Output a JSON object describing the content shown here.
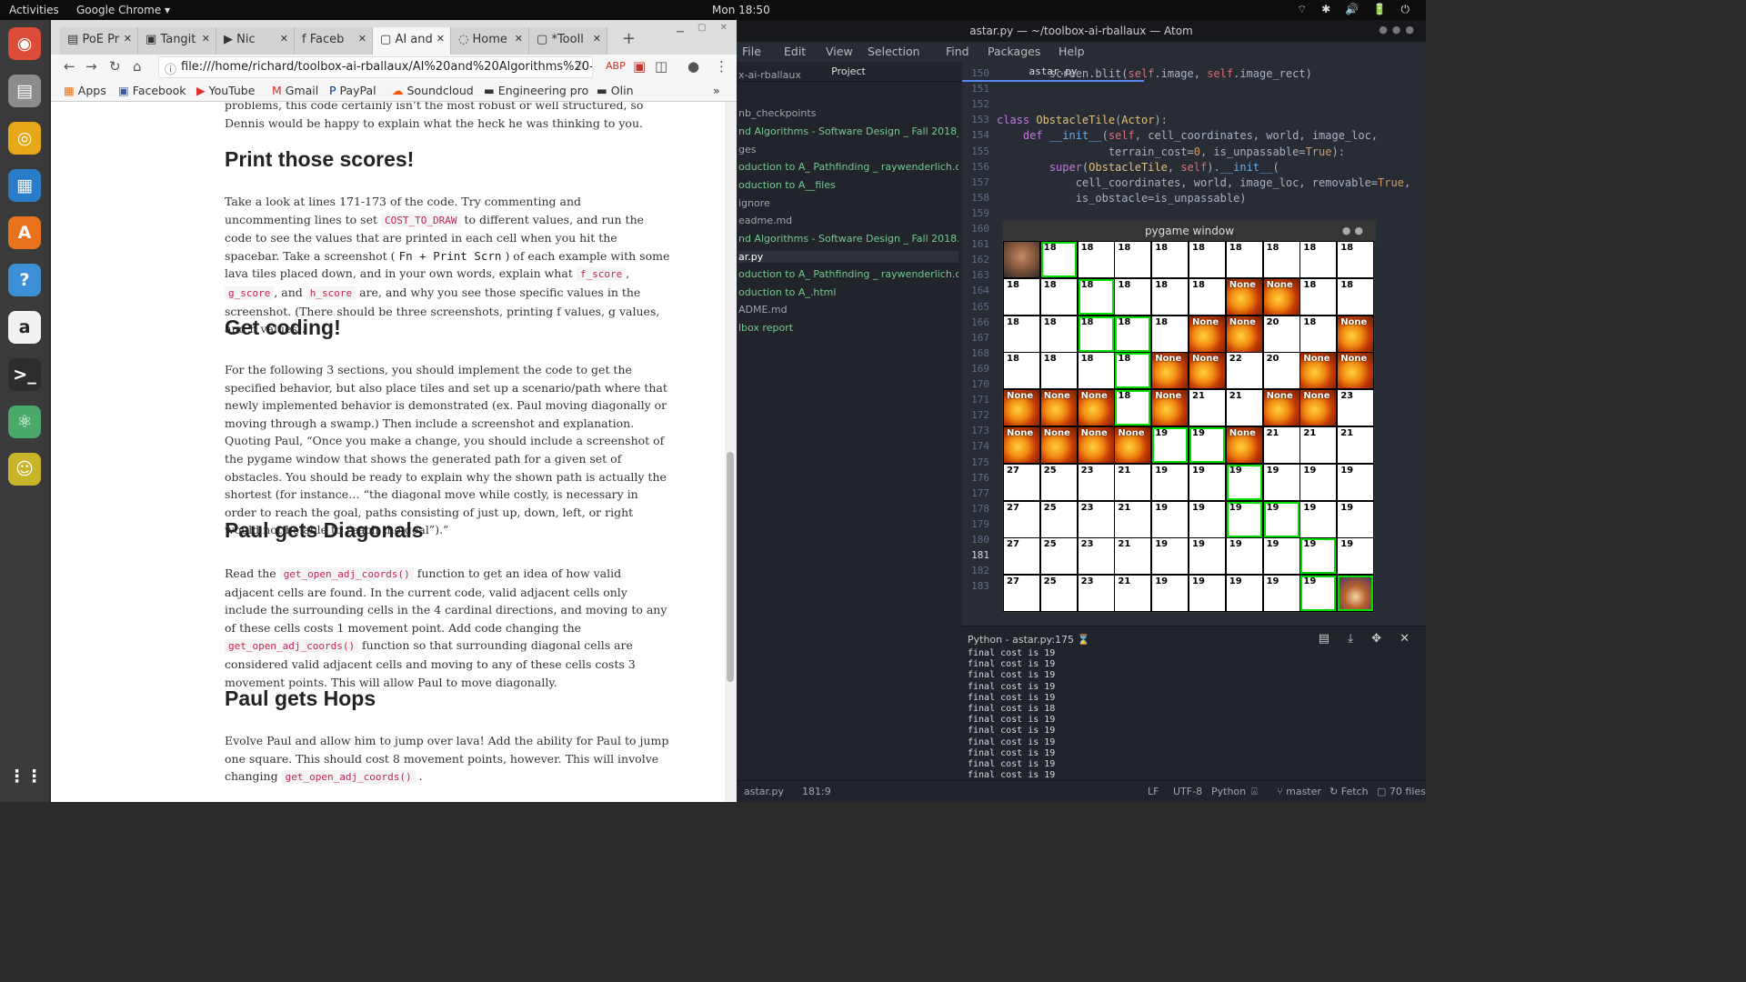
{
  "topbar": {
    "activities": "Activities",
    "app": "Google Chrome ▾",
    "clock": "Mon 18:50",
    "tray": "⌔ ✱ 🔊 🔋 ⏻"
  },
  "dock": [
    {
      "icon": "chrome-icon",
      "glyph": "◉",
      "color": "#dd4b39"
    },
    {
      "icon": "files-icon",
      "glyph": "▤",
      "color": "#8c8c8c"
    },
    {
      "icon": "rhythmbox-icon",
      "glyph": "◎",
      "color": "#e6a817"
    },
    {
      "icon": "writer-icon",
      "glyph": "▦",
      "color": "#2a7bc8"
    },
    {
      "icon": "software-center-icon",
      "glyph": "A",
      "color": "#e8731c"
    },
    {
      "icon": "help-icon",
      "glyph": "?",
      "color": "#3d8fd6"
    },
    {
      "icon": "amazon-icon",
      "glyph": "a",
      "color": "#f1f1f1"
    },
    {
      "icon": "terminal-icon",
      "glyph": ">_",
      "color": "#2d2d2d"
    },
    {
      "icon": "atom-icon",
      "glyph": "⚛",
      "color": "#4aa86a"
    },
    {
      "icon": "robot-icon",
      "glyph": "☺",
      "color": "#c8b428"
    },
    {
      "icon": "show-apps-icon",
      "glyph": "⋮⋮",
      "color": "#3a3a3a"
    }
  ],
  "chrome": {
    "tabs": [
      {
        "label": "PoE Pr",
        "icon": "▤",
        "active": false
      },
      {
        "label": "Tangit",
        "icon": "▣",
        "active": false
      },
      {
        "label": "Nic",
        "icon": "▶",
        "active": false
      },
      {
        "label": "Faceb",
        "icon": "f",
        "active": false
      },
      {
        "label": "AI and",
        "icon": "▢",
        "active": true
      },
      {
        "label": "Home",
        "icon": "◌",
        "active": false
      },
      {
        "label": "*Tooll",
        "icon": "▢",
        "active": false
      }
    ],
    "url": "file:///home/richard/toolbox-ai-rballaux/AI%20and%20Algorithms%20-%20Soft...",
    "bookmarks": [
      "Apps",
      "Facebook",
      "YouTube",
      "Gmail",
      "PayPal",
      "Soundcloud",
      "Engineering pro",
      "Olin"
    ],
    "more": "»"
  },
  "article": {
    "intro": "problems, this code certainly isn’t the most robust or well structured, so Dennis would be happy to explain what the heck he was thinking to you.",
    "h_print": "Print those scores!",
    "p_print_1": "Take a look at lines 171-173 of the code. Try commenting and uncommenting lines to set",
    "c_cost": "COST_TO_DRAW",
    "p_print_2": " to different values, and run the code to see the values that are printed in each cell when you hit the spacebar. Take a screenshot (",
    "c_key": "Fn + Print Scrn",
    "p_print_3": ") of each example with some lava tiles placed down, and in your own words, explain what",
    "c_f": "f_score",
    "c_g": "g_score",
    "p_and": ", and",
    "c_h": "h_score",
    "p_print_4": " are, and why you see those specific values in the screenshot. (There should be three screenshots, printing f values, g values, and h values).",
    "h_coding": "Get coding!",
    "p_coding": "For the following 3 sections, you should implement the code to get the specified behavior, but also place tiles and set up a scenario/path where that newly implemented behavior is demonstrated (ex. Paul moving diagonally or moving through a swamp.) Then include a screenshot and explanation. Quoting Paul, “Once you make a change, you should include a screenshot of the pygame window that shows the generated path for a given set of obstacles. You should be ready to explain why the shown path is actually the shortest (for instance… “the diagonal move while costly, is necessary in order to reach the goal, paths consisting of just up, down, left, or right would not be able to reach the goal”).”",
    "h_diag": "Paul gets Diagonals",
    "p_diag_1": "Read the ",
    "c_adj": "get_open_adj_coords()",
    "p_diag_2": " function to get an idea of how valid adjacent cells are found. In the current code, valid adjacent cells only include the surrounding cells in the 4 cardinal directions, and moving to any of these cells costs 1 movement point. Add code changing the ",
    "p_diag_3": " function so that surrounding diagonal cells are considered valid adjacent cells and moving to any of these cells costs 3 movement points. This will allow Paul to move diagonally.",
    "h_hops": "Paul gets Hops",
    "p_hops": "Evolve Paul and allow him to jump over lava! Add the ability for Paul to jump one square. This should cost 8 movement points, however. This will involve changing",
    "p_dot": "."
  },
  "atom": {
    "title": "astar.py — ~/toolbox-ai-rballaux — Atom",
    "menu": [
      "File",
      "Edit",
      "View",
      "Selection",
      "Find",
      "Packages",
      "Help"
    ],
    "project_label": "Project",
    "tab": "astar.py",
    "tree": [
      {
        "name": "x-ai-rballaux",
        "color": "#9da5b4"
      },
      {
        "name": "nb_checkpoints",
        "color": "#9da5b4"
      },
      {
        "name": "nd Algorithms - Software Design _ Fall 2018_files",
        "color": "#73c990"
      },
      {
        "name": "ges",
        "color": "#9da5b4"
      },
      {
        "name": "oduction to A_ Pathfinding _ raywenderlich.com_files",
        "color": "#73c990"
      },
      {
        "name": "oduction to A__files",
        "color": "#73c990"
      },
      {
        "name": "ignore",
        "color": "#9da5b4"
      },
      {
        "name": "eadme.md",
        "color": "#9da5b4"
      },
      {
        "name": "nd Algorithms - Software Design _ Fall 2018.html",
        "color": "#73c990"
      },
      {
        "name": "ar.py",
        "color": "#e2c08d"
      },
      {
        "name": "oduction to A_ Pathfinding _ raywenderlich.com.html",
        "color": "#73c990"
      },
      {
        "name": "oduction to A_.html",
        "color": "#73c990"
      },
      {
        "name": "ADME.md",
        "color": "#9da5b4"
      },
      {
        "name": "lbox report",
        "color": "#73c990"
      }
    ],
    "line_numbers": [
      "150",
      "151",
      "152",
      "153",
      "154",
      "155",
      "156",
      "157",
      "158",
      "159",
      "160",
      "161",
      "162",
      "163",
      "164",
      "165",
      "166",
      "167",
      "168",
      "169",
      "170",
      "171",
      "172",
      "173",
      "174",
      "175",
      "176",
      "177",
      "178",
      "179",
      "180",
      "181",
      "182",
      "183"
    ],
    "code": [
      "        screen.blit(self.image, self.image_rect)",
      "",
      "",
      "class ObstacleTile(Actor):",
      "    def __init__(self, cell_coordinates, world, image_loc,",
      "                 terrain_cost=0, is_unpassable=True):",
      "        super(ObstacleTile, self).__init__(",
      "            cell_coordinates, world, image_loc, removable=True,",
      "            is_obstacle=is_unpassable)"
    ],
    "console_title": "Python - astar.py:175",
    "console_lines": [
      "final cost is 19",
      "final cost is 19",
      "final cost is 19",
      "final cost is 19",
      "final cost is 19",
      "final cost is 18",
      "final cost is 19",
      "final cost is 19",
      "final cost is 19",
      "final cost is 19",
      "final cost is 19",
      "final cost is 19"
    ],
    "status": {
      "file": "astar.py",
      "pos": "181:9",
      "eol": "LF",
      "encoding": "UTF-8",
      "grammar": "Python",
      "branch": "master",
      "fetch": "Fetch",
      "files": "70 files"
    }
  },
  "pygame": {
    "title": "pygame window",
    "grid": [
      [
        "P",
        "18",
        "18",
        "18",
        "18",
        "18",
        "18",
        "18",
        "18",
        "18"
      ],
      [
        "18",
        "18",
        "18",
        "18",
        "18",
        "18",
        "None",
        "None",
        "18",
        "18"
      ],
      [
        "18",
        "18",
        "18",
        "18",
        "18",
        "None",
        "None",
        "20",
        "18",
        "None"
      ],
      [
        "18",
        "18",
        "18",
        "18",
        "None",
        "None",
        "22",
        "20",
        "None",
        "None"
      ],
      [
        "None",
        "None",
        "None",
        "18",
        "None",
        "21",
        "21",
        "None",
        "None",
        "23"
      ],
      [
        "None",
        "None",
        "None",
        "None",
        "19",
        "19",
        "None",
        "21",
        "21",
        "21"
      ],
      [
        "27",
        "25",
        "23",
        "21",
        "19",
        "19",
        "19",
        "19",
        "19",
        "19"
      ],
      [
        "27",
        "25",
        "23",
        "21",
        "19",
        "19",
        "19",
        "19",
        "19",
        "19"
      ],
      [
        "27",
        "25",
        "23",
        "21",
        "19",
        "19",
        "19",
        "19",
        "19",
        "19"
      ],
      [
        "27",
        "25",
        "23",
        "21",
        "19",
        "19",
        "19",
        "19",
        "19",
        "C"
      ]
    ],
    "path": [
      [
        0,
        1
      ],
      [
        1,
        2
      ],
      [
        2,
        2
      ],
      [
        2,
        3
      ],
      [
        3,
        3
      ],
      [
        4,
        3
      ],
      [
        5,
        4
      ],
      [
        5,
        5
      ],
      [
        6,
        6
      ],
      [
        7,
        6
      ],
      [
        7,
        7
      ],
      [
        8,
        8
      ],
      [
        9,
        8
      ]
    ],
    "path_color": "#00e000",
    "lava_color": "#f18a12"
  }
}
